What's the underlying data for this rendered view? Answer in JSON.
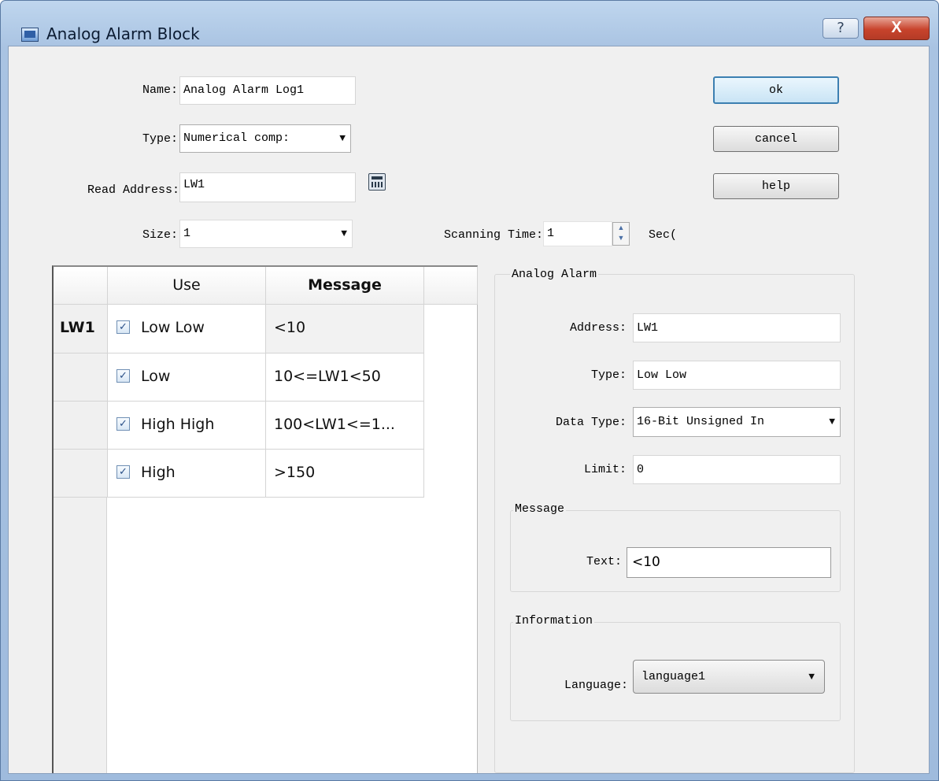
{
  "window": {
    "title": "Analog Alarm Block",
    "help_label": "?",
    "close_label": "X"
  },
  "form": {
    "name_label": "Name:",
    "name_value": "Analog Alarm Log1",
    "type_label": "Type:",
    "type_value": "Numerical comp:",
    "read_address_label": "Read Address:",
    "read_address_value": "LW1",
    "size_label": "Size:",
    "size_value": "1",
    "scanning_time_label": "Scanning Time:",
    "scanning_time_value": "1",
    "seconds_label": "Sec("
  },
  "buttons": {
    "ok": "ok",
    "cancel": "cancel",
    "help": "help"
  },
  "grid": {
    "columns": [
      "Use",
      "Message"
    ],
    "rows": [
      {
        "header": "LW1",
        "checked": true,
        "use": "Low Low",
        "message": "<10"
      },
      {
        "header": "",
        "checked": true,
        "use": "Low",
        "message": "10<=LW1<50"
      },
      {
        "header": "",
        "checked": true,
        "use": "High High",
        "message": "100<LW1<=1..."
      },
      {
        "header": "",
        "checked": true,
        "use": "High",
        "message": ">150"
      }
    ]
  },
  "analog_alarm": {
    "group_title": "Analog Alarm",
    "address_label": "Address:",
    "address_value": "LW1",
    "type_label": "Type:",
    "type_value": "Low Low",
    "data_type_label": "Data Type:",
    "data_type_value": "16-Bit Unsigned In",
    "limit_label": "Limit:",
    "limit_value": "0",
    "message_group_title": "Message",
    "text_label": "Text:",
    "text_value": "<10",
    "information_group_title": "Information",
    "language_label": "Language:",
    "language_value": "language1"
  },
  "colors": {
    "title_bar": "#a9c3e2",
    "close_button": "#c8432c",
    "default_button_border": "#3c7fb1"
  }
}
